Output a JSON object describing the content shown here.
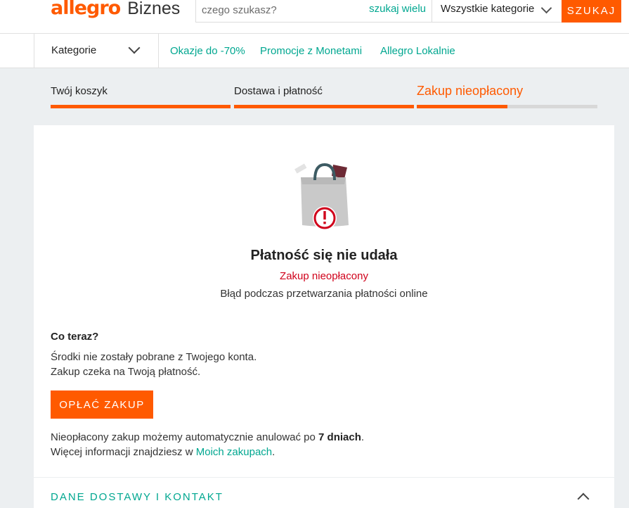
{
  "header": {
    "logo_word": "allegro",
    "logo_suffix": "Biznes",
    "search_placeholder": "czego szukasz?",
    "search_many": "szukaj wielu",
    "category": "Wszystkie kategorie",
    "search_button": "SZUKAJ"
  },
  "nav": {
    "categories": "Kategorie",
    "links": [
      "Okazje do -70%",
      "Promocje z Monetami",
      "Allegro Lokalnie"
    ]
  },
  "steps": [
    {
      "label": "Twój koszyk",
      "progress": 1.0
    },
    {
      "label": "Dostawa i płatność",
      "progress": 1.0
    },
    {
      "label": "Zakup nieopłacony",
      "progress": 0.5
    }
  ],
  "result": {
    "title": "Płatność się nie udała",
    "status": "Zakup nieopłacony",
    "error": "Błąd podczas przetwarzania płatności online",
    "what_now": "Co teraz?",
    "line1": "Środki nie zostały pobrane z Twojego konta.",
    "line2": "Zakup czeka na Twoją płatność.",
    "pay_button": "OPŁAĆ ZAKUP",
    "info_prefix": "Nieopłacony zakup możemy automatycznie anulować po ",
    "info_days": "7 dniach",
    "info_suffix": ".",
    "more_prefix": "Więcej informacji znajdziesz w ",
    "more_link": "Moich zakupach",
    "more_suffix": "."
  },
  "delivery_section": {
    "title": "DANE DOSTAWY I KONTAKT"
  },
  "colors": {
    "brand": "#ff5a00",
    "link": "#00a790",
    "error": "#d0021b"
  }
}
